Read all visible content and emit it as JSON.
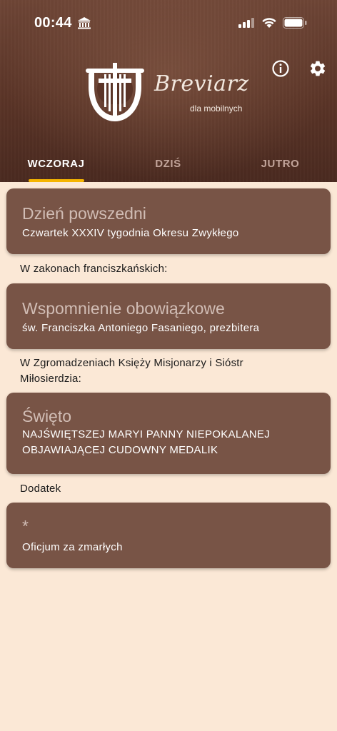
{
  "status_bar": {
    "time": "00:44",
    "icons": [
      "bank-icon",
      "signal-icon",
      "wifi-icon",
      "battery-icon"
    ]
  },
  "header": {
    "logo_title": "Breviarz",
    "logo_subtitle": "dla mobilnych",
    "icons": [
      "info-icon",
      "gear-icon"
    ]
  },
  "tabs": [
    {
      "label": "WCZORAJ",
      "active": true
    },
    {
      "label": "DZIŚ",
      "active": false
    },
    {
      "label": "JUTRO",
      "active": false
    }
  ],
  "entries": [
    {
      "section": "",
      "title": "Dzień powszedni",
      "subtitle": "Czwartek XXXIV tygodnia Okresu Zwykłego"
    },
    {
      "section": "W zakonach franciszkańskich:",
      "title": "Wspomnienie obowiązkowe",
      "subtitle": "św. Franciszka Antoniego Fasaniego, prezbitera"
    },
    {
      "section_line1": "W Zgromadzeniach Księży Misjonarzy i Sióstr",
      "section_line2": "Miłosierdzia:",
      "title": "Święto",
      "subtitle_line1": "NAJŚWIĘTSZEJ MARYI PANNY NIEPOKALANEJ",
      "subtitle_line2": "OBJAWIAJĄCEJ CUDOWNY MEDALIK"
    },
    {
      "section": "Dodatek",
      "title": "*",
      "subtitle": "Oficjum za zmarłych"
    }
  ],
  "colors": {
    "header_brown": "#5a3427",
    "card_brown": "#785446",
    "page_background": "#fbe8d6",
    "tab_indicator": "#f5b400"
  }
}
